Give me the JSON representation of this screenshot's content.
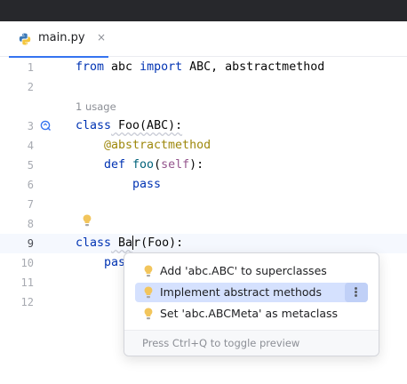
{
  "editor_tab": {
    "filename": "main.py",
    "close_glyph": "×",
    "icon": "python-file-icon"
  },
  "gutter": [
    "1",
    "2",
    "3",
    "4",
    "5",
    "6",
    "7",
    "8",
    "9",
    "10",
    "11",
    "12"
  ],
  "usage_hint": "1 usage",
  "code": {
    "l1": {
      "a": "from",
      "b": " abc ",
      "c": "import",
      "d": " ABC, abstractmethod"
    },
    "l3": {
      "a": "class",
      "b": " Foo(ABC):"
    },
    "l4": {
      "a": "@abstractmethod"
    },
    "l5": {
      "a": "def",
      "b": " ",
      "c": "foo",
      "d": "(",
      "e": "self",
      "f": "):"
    },
    "l6": {
      "a": "pass"
    },
    "l9": {
      "a": "class",
      "b": " Ba",
      "c": "r(Foo):"
    },
    "l10": {
      "a": "pas"
    }
  },
  "intention_popup": {
    "items": [
      "Add 'abc.ABC' to superclasses",
      "Implement abstract methods",
      "Set 'abc.ABCMeta' as metaclass"
    ],
    "selected_index": 1,
    "footer": "Press Ctrl+Q to toggle preview"
  },
  "colors": {
    "keyword": "#0033b3",
    "decorator": "#9e880d",
    "function": "#00627a",
    "self": "#94558d",
    "selection": "#d5e1fe",
    "accent": "#3574f0",
    "bulb": "#f2c55c"
  }
}
